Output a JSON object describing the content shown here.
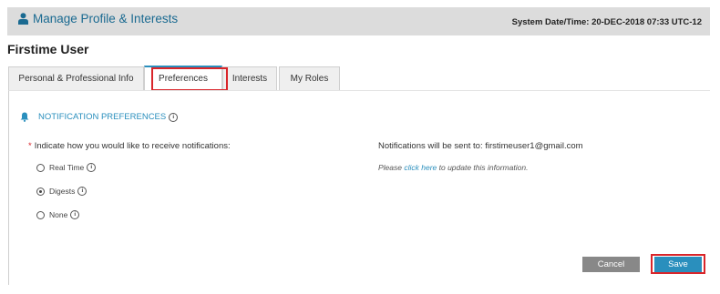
{
  "header": {
    "title": "Manage Profile & Interests",
    "system_datetime": "System Date/Time: 20-DEC-2018   07:33 UTC-12"
  },
  "user": {
    "name": "Firstime User"
  },
  "tabs": [
    {
      "label": "Personal & Professional Info",
      "active": false
    },
    {
      "label": "Preferences",
      "active": true
    },
    {
      "label": "Interests",
      "active": false
    },
    {
      "label": "My Roles",
      "active": false
    }
  ],
  "notification": {
    "section_title": "NOTIFICATION PREFERENCES",
    "question": "Indicate how you would like to receive notifications:",
    "options": [
      {
        "label": "Real Time",
        "checked": false
      },
      {
        "label": "Digests",
        "checked": true
      },
      {
        "label": "None",
        "checked": false
      }
    ],
    "sent_to_label": "Notifications will be sent to: firstimeuser1@gmail.com",
    "update_prefix": "Please ",
    "update_link": "click here",
    "update_suffix": " to update this information."
  },
  "actions": {
    "cancel": "Cancel",
    "save": "Save"
  },
  "colors": {
    "accent": "#2a8fbd",
    "highlight": "#d9252a",
    "header_bg": "#dcdcdc",
    "cancel_bg": "#888888"
  }
}
